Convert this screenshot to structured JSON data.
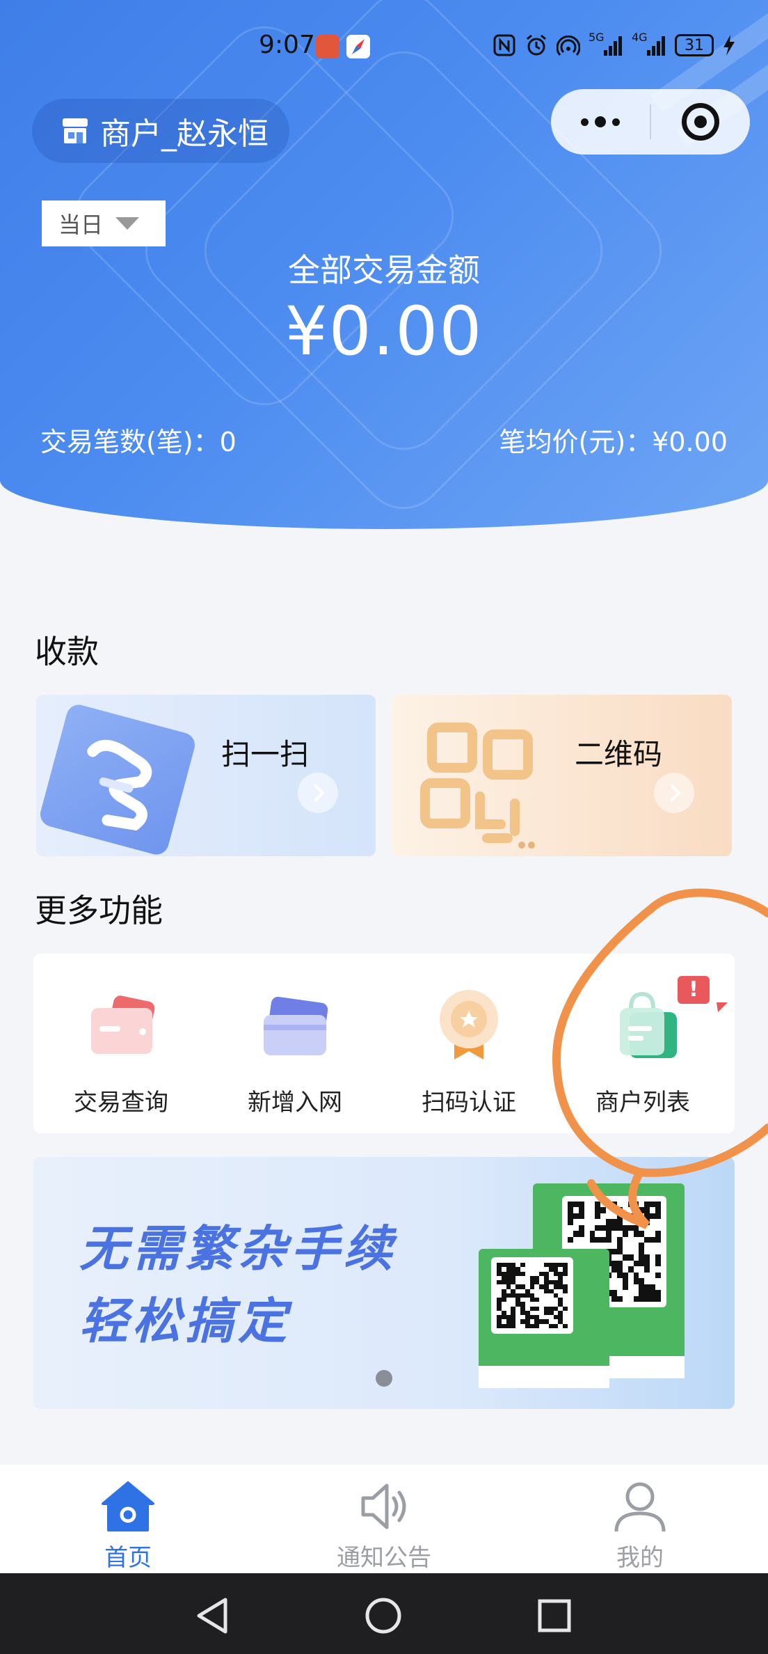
{
  "status_bar": {
    "time": "9:07",
    "battery": "31",
    "network_label_1": "5G",
    "network_label_2": "4G"
  },
  "header": {
    "merchant_name": "商户_赵永恒",
    "date_filter": "当日",
    "total_label": "全部交易金额",
    "total_amount": "¥0.00",
    "tx_count_label": "交易笔数(笔)：",
    "tx_count_value": "0",
    "avg_price_label": "笔均价(元)：",
    "avg_price_value": "¥0.00"
  },
  "collect": {
    "title": "收款",
    "scan_label": "扫一扫",
    "qr_label": "二维码"
  },
  "more": {
    "title": "更多功能",
    "items": [
      {
        "label": "交易查询",
        "icon": "card-search-icon"
      },
      {
        "label": "新增入网",
        "icon": "bank-cards-icon"
      },
      {
        "label": "扫码认证",
        "icon": "medal-icon"
      },
      {
        "label": "商户列表",
        "icon": "shopping-bag-icon"
      }
    ],
    "badge": "!"
  },
  "banner": {
    "line1": "无需繁杂手续",
    "line2": "轻松搞定"
  },
  "tabbar": {
    "items": [
      {
        "label": "首页",
        "icon": "home-icon",
        "active": true
      },
      {
        "label": "通知公告",
        "icon": "speaker-icon",
        "active": false
      },
      {
        "label": "我的",
        "icon": "user-icon",
        "active": false
      }
    ]
  },
  "colors": {
    "header_blue": "#4c8cf0",
    "active_tab": "#2f72e6",
    "inactive_tab": "#9b9ea4",
    "badge_red": "#e9585a",
    "annotation_orange": "#f0924a"
  }
}
